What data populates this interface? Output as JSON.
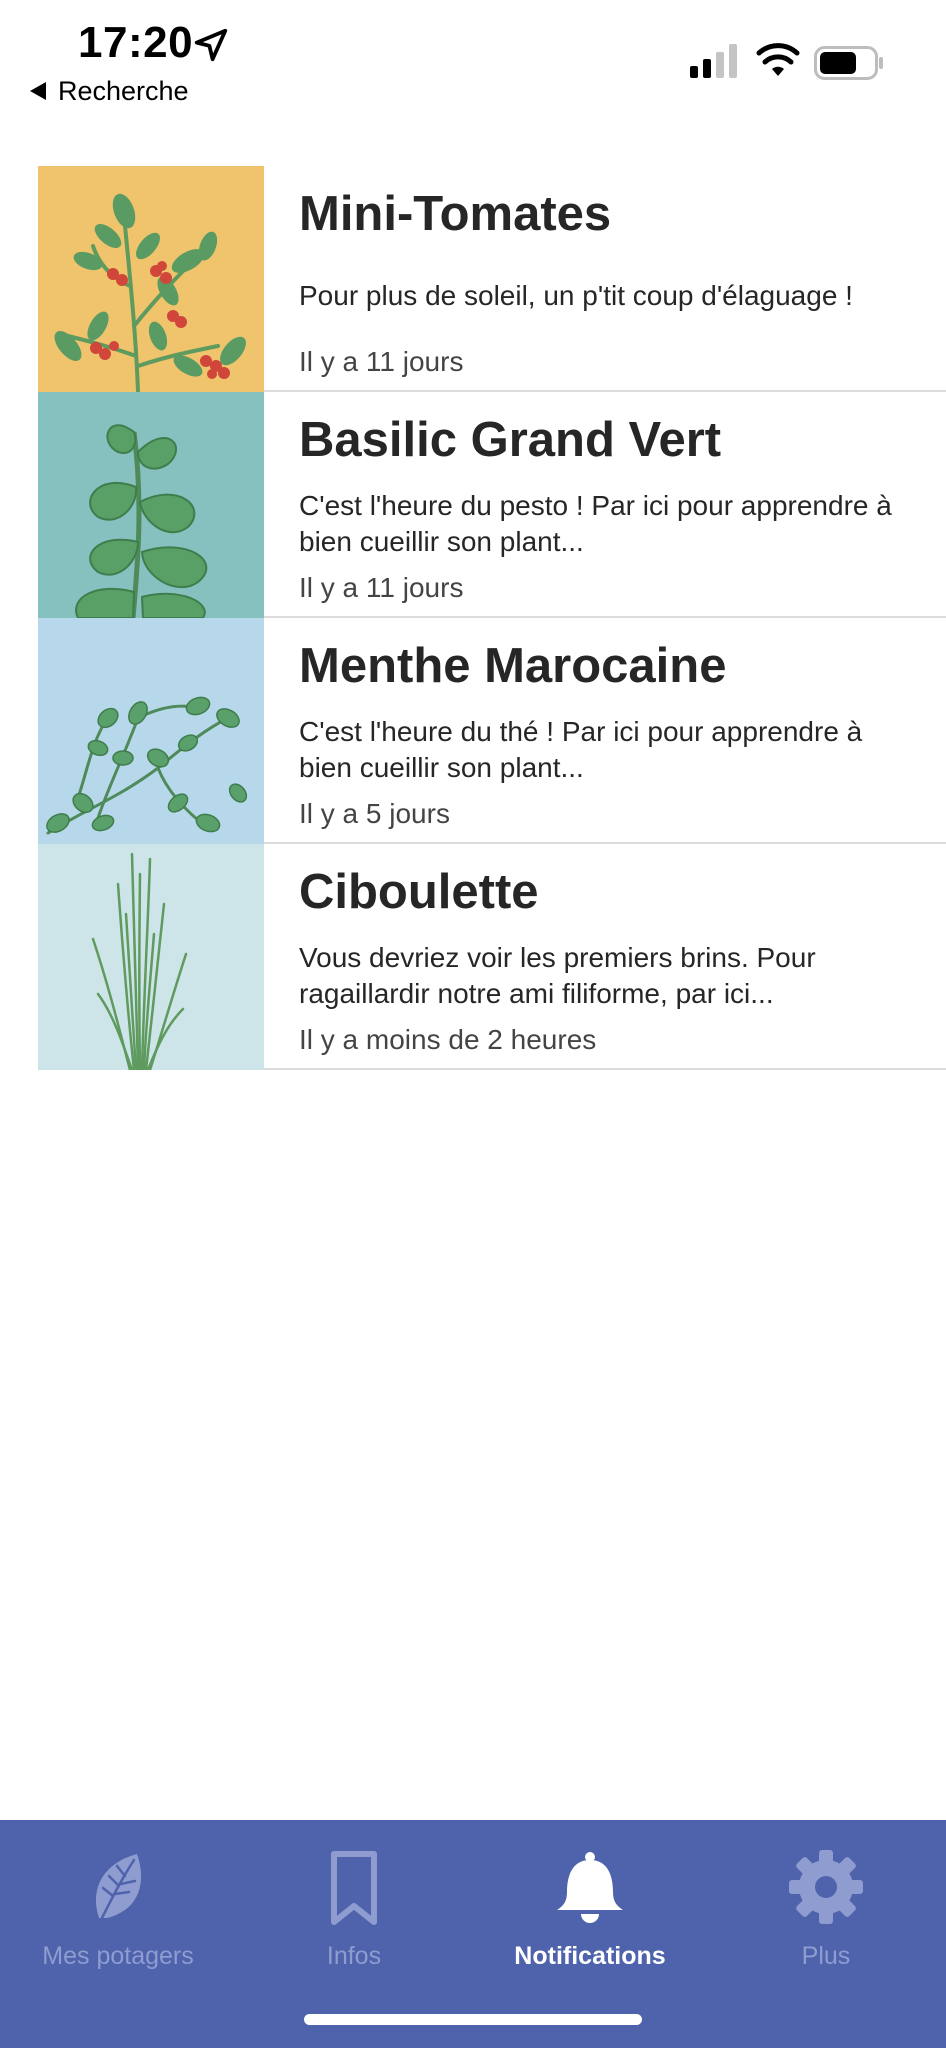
{
  "status_bar": {
    "time": "17:20",
    "back_label": "Recherche",
    "icons": [
      "location-arrow-icon",
      "cellular-signal-icon",
      "wifi-icon",
      "battery-icon"
    ]
  },
  "notifications": [
    {
      "title": "Mini-Tomates",
      "description": "Pour plus de soleil, un p'tit coup d'élaguage !",
      "date": "Il y a 11 jours",
      "thumb_color": "#efc46c",
      "illustration": "tomato-plant-illustration"
    },
    {
      "title": "Basilic Grand Vert",
      "description": "C'est l'heure du pesto ! Par ici pour apprendre à bien cueillir son plant...",
      "date": "Il y a 11 jours",
      "thumb_color": "#86c0bf",
      "illustration": "basil-plant-illustration"
    },
    {
      "title": "Menthe Marocaine",
      "description": "C'est l'heure du thé ! Par ici pour apprendre à bien cueillir son plant...",
      "date": "Il y a 5 jours",
      "thumb_color": "#b7d8ea",
      "illustration": "mint-plant-illustration"
    },
    {
      "title": "Ciboulette",
      "description": "Vous devriez voir les premiers brins. Pour ragaillardir notre ami filiforme, par ici...",
      "date": "Il y a moins de 2 heures",
      "thumb_color": "#cde4e9",
      "illustration": "chives-illustration"
    }
  ],
  "tab_bar": {
    "background": "#4f63ad",
    "tabs": [
      {
        "label": "Mes potagers",
        "icon": "leaf-icon",
        "active": false
      },
      {
        "label": "Infos",
        "icon": "bookmark-icon",
        "active": false
      },
      {
        "label": "Notifications",
        "icon": "bell-icon",
        "active": true
      },
      {
        "label": "Plus",
        "icon": "gear-icon",
        "active": false
      }
    ]
  }
}
